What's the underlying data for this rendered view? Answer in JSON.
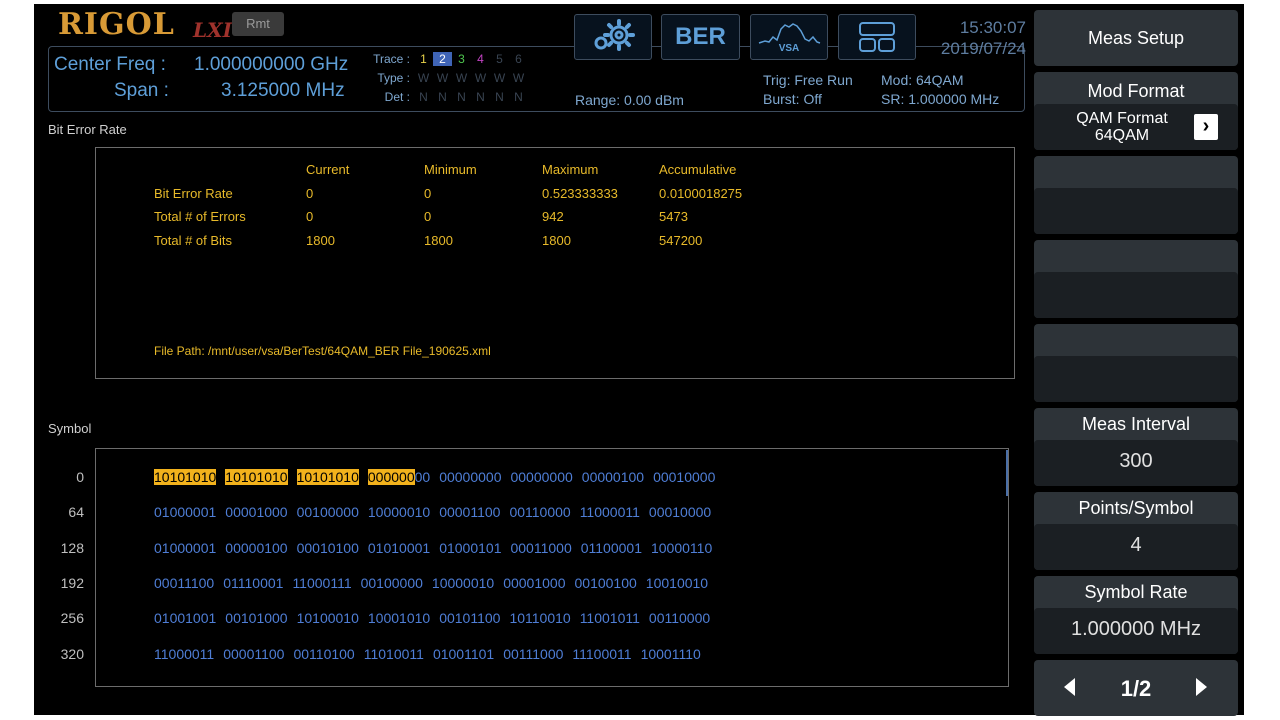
{
  "brand": {
    "logo": "RIGOL",
    "lxi": "LXI",
    "rmt": "Rmt"
  },
  "header": {
    "center_freq_label": "Center Freq :",
    "center_freq_value": "1.000000000 GHz",
    "span_label": "Span :",
    "span_value": "3.125000 MHz",
    "trace_label": "Trace :",
    "type_label": "Type :",
    "det_label": "Det :",
    "trace_numbers": [
      "1",
      "2",
      "3",
      "4",
      "5",
      "6"
    ],
    "type_values": [
      "W",
      "W",
      "W",
      "W",
      "W",
      "W"
    ],
    "det_values": [
      "N",
      "N",
      "N",
      "N",
      "N",
      "N"
    ],
    "range": "Range: 0.00 dBm",
    "trig": "Trig: Free Run",
    "burst": "Burst: Off",
    "mod": "Mod: 64QAM",
    "sr": "SR: 1.000000 MHz",
    "ber_button": "BER",
    "vsa_label": "VSA",
    "time": "15:30:07",
    "date": "2019/07/24"
  },
  "ber_section": {
    "title": "Bit Error Rate",
    "columns": [
      "Current",
      "Minimum",
      "Maximum",
      "Accumulative"
    ],
    "rows": [
      {
        "label": "Bit Error Rate",
        "values": [
          "0",
          "0",
          "0.523333333",
          "0.0100018275"
        ]
      },
      {
        "label": "Total # of Errors",
        "values": [
          "0",
          "0",
          "942",
          "5473"
        ]
      },
      {
        "label": "Total # of Bits",
        "values": [
          "1800",
          "1800",
          "1800",
          "547200"
        ]
      }
    ],
    "file_path": "File Path: /mnt/user/vsa/BerTest/64QAM_BER File_190625.xml"
  },
  "symbol_section": {
    "title": "Symbol",
    "rows": [
      {
        "index": "0",
        "groups": [
          "10101010",
          "10101010",
          "10101010",
          "00000000",
          "00000000",
          "00000000",
          "00000100",
          "00010000"
        ]
      },
      {
        "index": "64",
        "groups": [
          "01000001",
          "00001000",
          "00100000",
          "10000010",
          "00001100",
          "00110000",
          "11000011",
          "00010000"
        ]
      },
      {
        "index": "128",
        "groups": [
          "01000001",
          "00000100",
          "00010100",
          "01010001",
          "01000101",
          "00011000",
          "01100001",
          "10000110"
        ]
      },
      {
        "index": "192",
        "groups": [
          "00011100",
          "01110001",
          "11000111",
          "00100000",
          "10000010",
          "00001000",
          "00100100",
          "10010010"
        ]
      },
      {
        "index": "256",
        "groups": [
          "01001001",
          "00101000",
          "10100010",
          "10001010",
          "00101100",
          "10110010",
          "11001011",
          "00110000"
        ]
      },
      {
        "index": "320",
        "groups": [
          "11000011",
          "00001100",
          "00110100",
          "11010011",
          "01001101",
          "00111000",
          "11100011",
          "10001110"
        ]
      }
    ]
  },
  "softkeys": {
    "meas_setup": "Meas Setup",
    "mod_format": "Mod Format",
    "qam_format_label": "QAM Format",
    "qam_format_value": "64QAM",
    "meas_interval": "Meas Interval",
    "meas_interval_value": "300",
    "points_per_symbol": "Points/Symbol",
    "points_per_symbol_value": "4",
    "symbol_rate": "Symbol Rate",
    "symbol_rate_value": "1.000000 MHz",
    "page": "1/2"
  },
  "colors": {
    "accent_blue": "#5e9fd8",
    "highlight": "#f2b21c",
    "yellow_text": "#e8ba2a",
    "bit_blue": "#4f7ed6"
  }
}
